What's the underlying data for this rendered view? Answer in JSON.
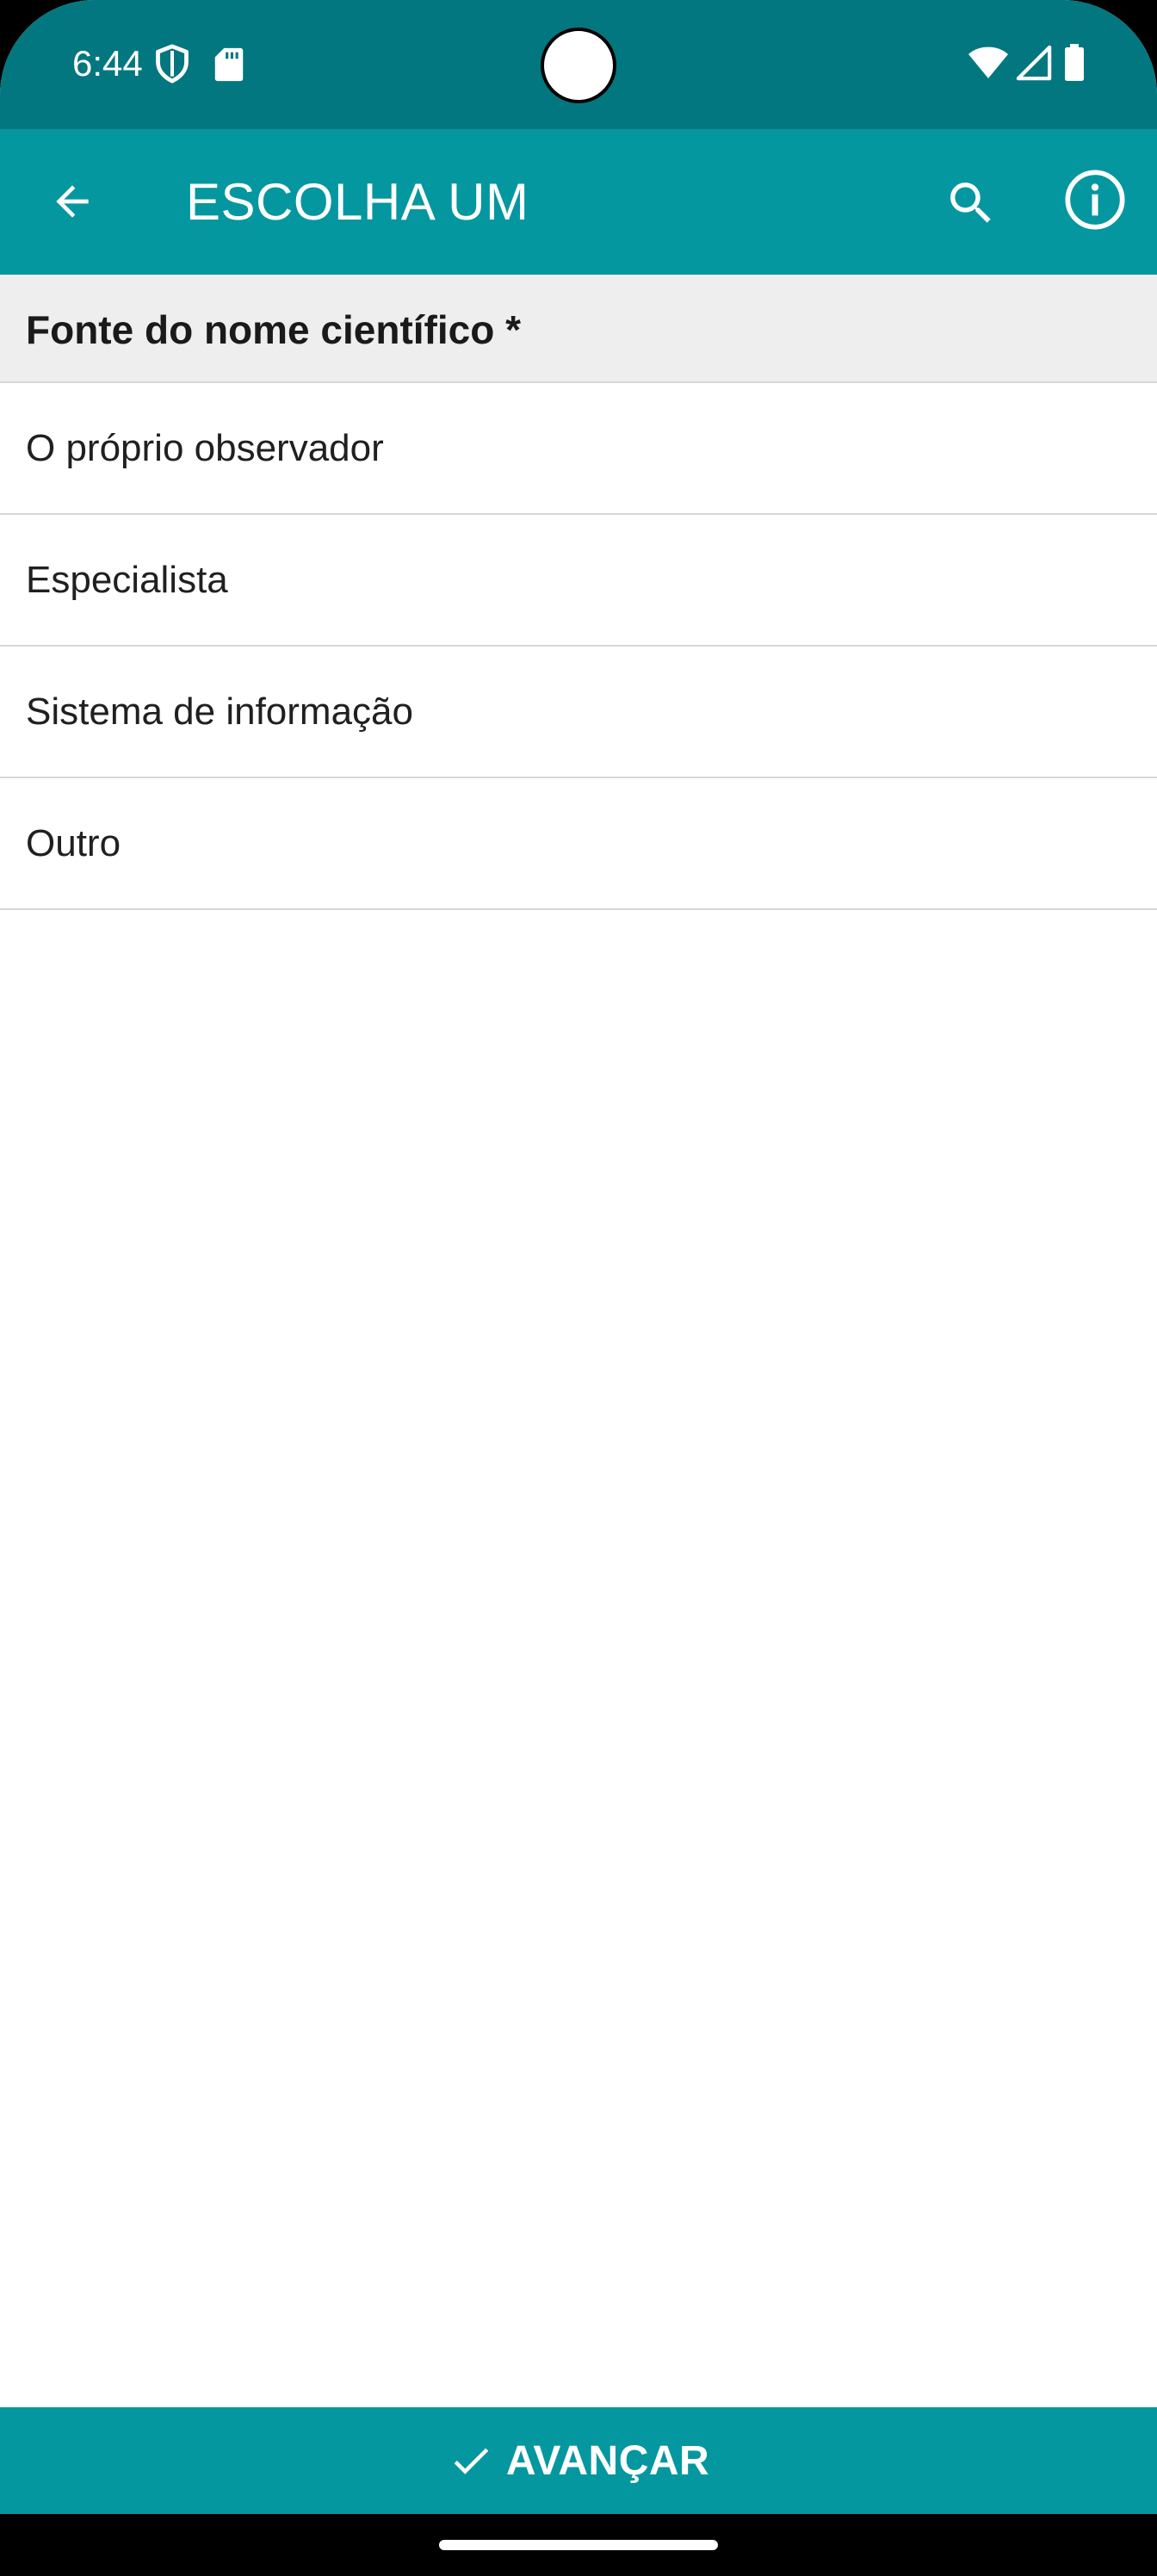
{
  "status_bar": {
    "time": "6:44",
    "icons": [
      "shield-icon",
      "sd-card-icon",
      "wifi-icon",
      "signal-icon",
      "battery-icon"
    ]
  },
  "app_bar": {
    "title": "ESCOLHA UM",
    "icons": [
      "back-arrow-icon",
      "search-icon",
      "info-icon"
    ]
  },
  "question": {
    "label": "Fonte do nome científico *"
  },
  "options": [
    {
      "label": "O próprio observador"
    },
    {
      "label": "Especialista"
    },
    {
      "label": "Sistema de informação"
    },
    {
      "label": "Outro"
    }
  ],
  "footer": {
    "next_label": "AVANÇAR",
    "icon": "check-icon"
  },
  "colors": {
    "status_bar": "#03777f",
    "primary": "#05979f",
    "header_bg": "#eeeeee",
    "divider": "#d6d6d6",
    "text": "#202020"
  }
}
